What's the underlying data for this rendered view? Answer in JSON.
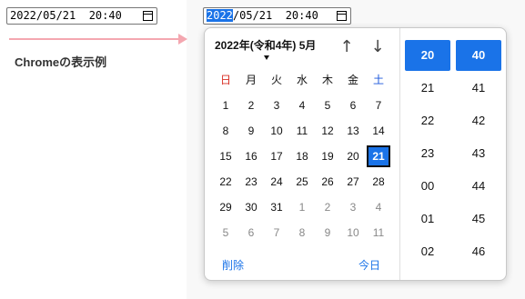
{
  "left_input": {
    "value": "2022/05/21  20:40"
  },
  "right_input": {
    "year": "2022",
    "rest": "/05/21  20:40"
  },
  "caption": "Chromeの表示例",
  "calendar": {
    "month_label": "2022年(令和4年) 5月",
    "prev_icon": "arrow-up-icon",
    "next_icon": "arrow-down-icon",
    "prev_glyph": "↑",
    "next_glyph": "↓",
    "weekdays": [
      "日",
      "月",
      "火",
      "水",
      "木",
      "金",
      "土"
    ],
    "weeks": [
      [
        "1",
        "2",
        "3",
        "4",
        "5",
        "6",
        "7"
      ],
      [
        "8",
        "9",
        "10",
        "11",
        "12",
        "13",
        "14"
      ],
      [
        "15",
        "16",
        "17",
        "18",
        "19",
        "20",
        "21"
      ],
      [
        "22",
        "23",
        "24",
        "25",
        "26",
        "27",
        "28"
      ],
      [
        "29",
        "30",
        "31",
        "1",
        "2",
        "3",
        "4"
      ],
      [
        "5",
        "6",
        "7",
        "8",
        "9",
        "10",
        "11"
      ]
    ],
    "selected_day": "21",
    "clear_label": "削除",
    "today_label": "今日"
  },
  "time": {
    "hours": [
      "20",
      "21",
      "22",
      "23",
      "00",
      "01",
      "02"
    ],
    "minutes": [
      "40",
      "41",
      "42",
      "43",
      "44",
      "45",
      "46"
    ],
    "selected_hour": "20",
    "selected_minute": "40"
  },
  "colors": {
    "accent": "#1a73e8",
    "sunday": "#d93025",
    "saturday": "#1a56db",
    "arrow": "#f4a7b0"
  }
}
